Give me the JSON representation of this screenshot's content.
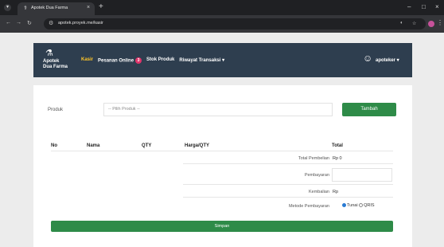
{
  "browser": {
    "tab_title": "Apotek Dua Farma",
    "tab_close": "×",
    "new_tab": "+",
    "url": "apotek.proyek.me/kasir",
    "window_controls": [
      "–",
      "□",
      "×"
    ]
  },
  "navbar": {
    "brand_line1": "Apotek",
    "brand_line2": "Dua Farma",
    "links": [
      {
        "label": "Kasir",
        "active": true
      },
      {
        "label": "Pesanan Online",
        "badge": "3"
      },
      {
        "label": "Stok Produk"
      },
      {
        "label": "Riwayat Transaksi ▾"
      }
    ],
    "user": "apoteker ▾"
  },
  "form": {
    "produk_label": "Produk",
    "produk_placeholder": "-- Pilih Produk --",
    "tambah_button": "Tambah"
  },
  "table": {
    "headers": [
      "No",
      "Nama",
      "QTY",
      "Harga/QTY",
      "Total"
    ]
  },
  "summary": {
    "total_label": "Total Pembelian",
    "total_value": "Rp 0",
    "bayar_label": "Pembayaran",
    "kembalian_label": "Kembalian",
    "kembalian_value": "Rp",
    "metode_label": "Metode Pembayaran",
    "metode_options": [
      "Tunai",
      "QRIS"
    ],
    "metode_selected": "Tunai"
  },
  "simpan_button": "Simpan"
}
